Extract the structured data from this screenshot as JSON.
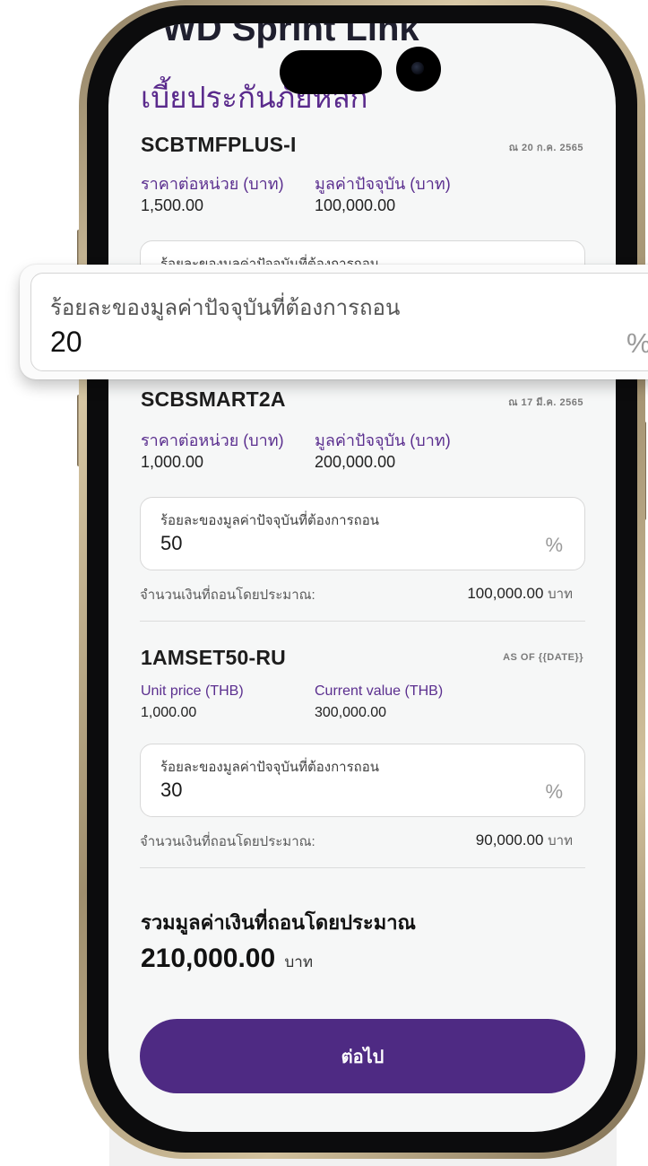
{
  "app": {
    "header": "WD Sprint Link",
    "section_title": "เบี้ยประกันภัยหลัก"
  },
  "funds": [
    {
      "name": "SCBTMFPLUS-I",
      "date": "ณ 20 ก.ค. 2565",
      "unit_price_label": "ราคาต่อหน่วย (บาท)",
      "unit_price": "1,500.00",
      "current_value_label": "มูลค่าปัจจุบัน (บาท)",
      "current_value": "100,000.00",
      "withdraw_label": "ร้อยละของมูลค่าปัจจุบันที่ต้องการถอน",
      "withdraw_percent": "20"
    },
    {
      "name": "SCBSMART2A",
      "date": "ณ 17 มี.ค. 2565",
      "unit_price_label": "ราคาต่อหน่วย (บาท)",
      "unit_price": "1,000.00",
      "current_value_label": "มูลค่าปัจจุบัน (บาท)",
      "current_value": "200,000.00",
      "withdraw_label": "ร้อยละของมูลค่าปัจจุบันที่ต้องการถอน",
      "withdraw_percent": "50",
      "estimated_label": "จำนวนเงินที่ถอนโดยประมาณ:",
      "estimated_amount": "100,000.00",
      "currency": "บาท"
    },
    {
      "name": "1AMSET50-RU",
      "date": "AS OF {{DATE}}",
      "unit_price_label": "Unit price (THB)",
      "unit_price": "1,000.00",
      "current_value_label": "Current value (THB)",
      "current_value": "300,000.00",
      "withdraw_label": "ร้อยละของมูลค่าปัจจุบันที่ต้องการถอน",
      "withdraw_percent": "30",
      "estimated_label": "จำนวนเงินที่ถอนโดยประมาณ:",
      "estimated_amount": "90,000.00",
      "currency": "บาท"
    }
  ],
  "percent_symbol": "%",
  "total": {
    "label": "รวมมูลค่าเงินที่ถอนโดยประมาณ",
    "amount": "210,000.00",
    "currency": "บาท"
  },
  "next_button": "ต่อไป",
  "callout": {
    "label": "ร้อยละของมูลค่าปัจจุบันที่ต้องการถอน",
    "value": "20",
    "percent_symbol": "%"
  },
  "colors": {
    "brand_purple": "#4e2a83",
    "label_purple": "#5b2f8f",
    "screen_bg": "#f6f7f7",
    "frame_gold": "#c9b896"
  }
}
